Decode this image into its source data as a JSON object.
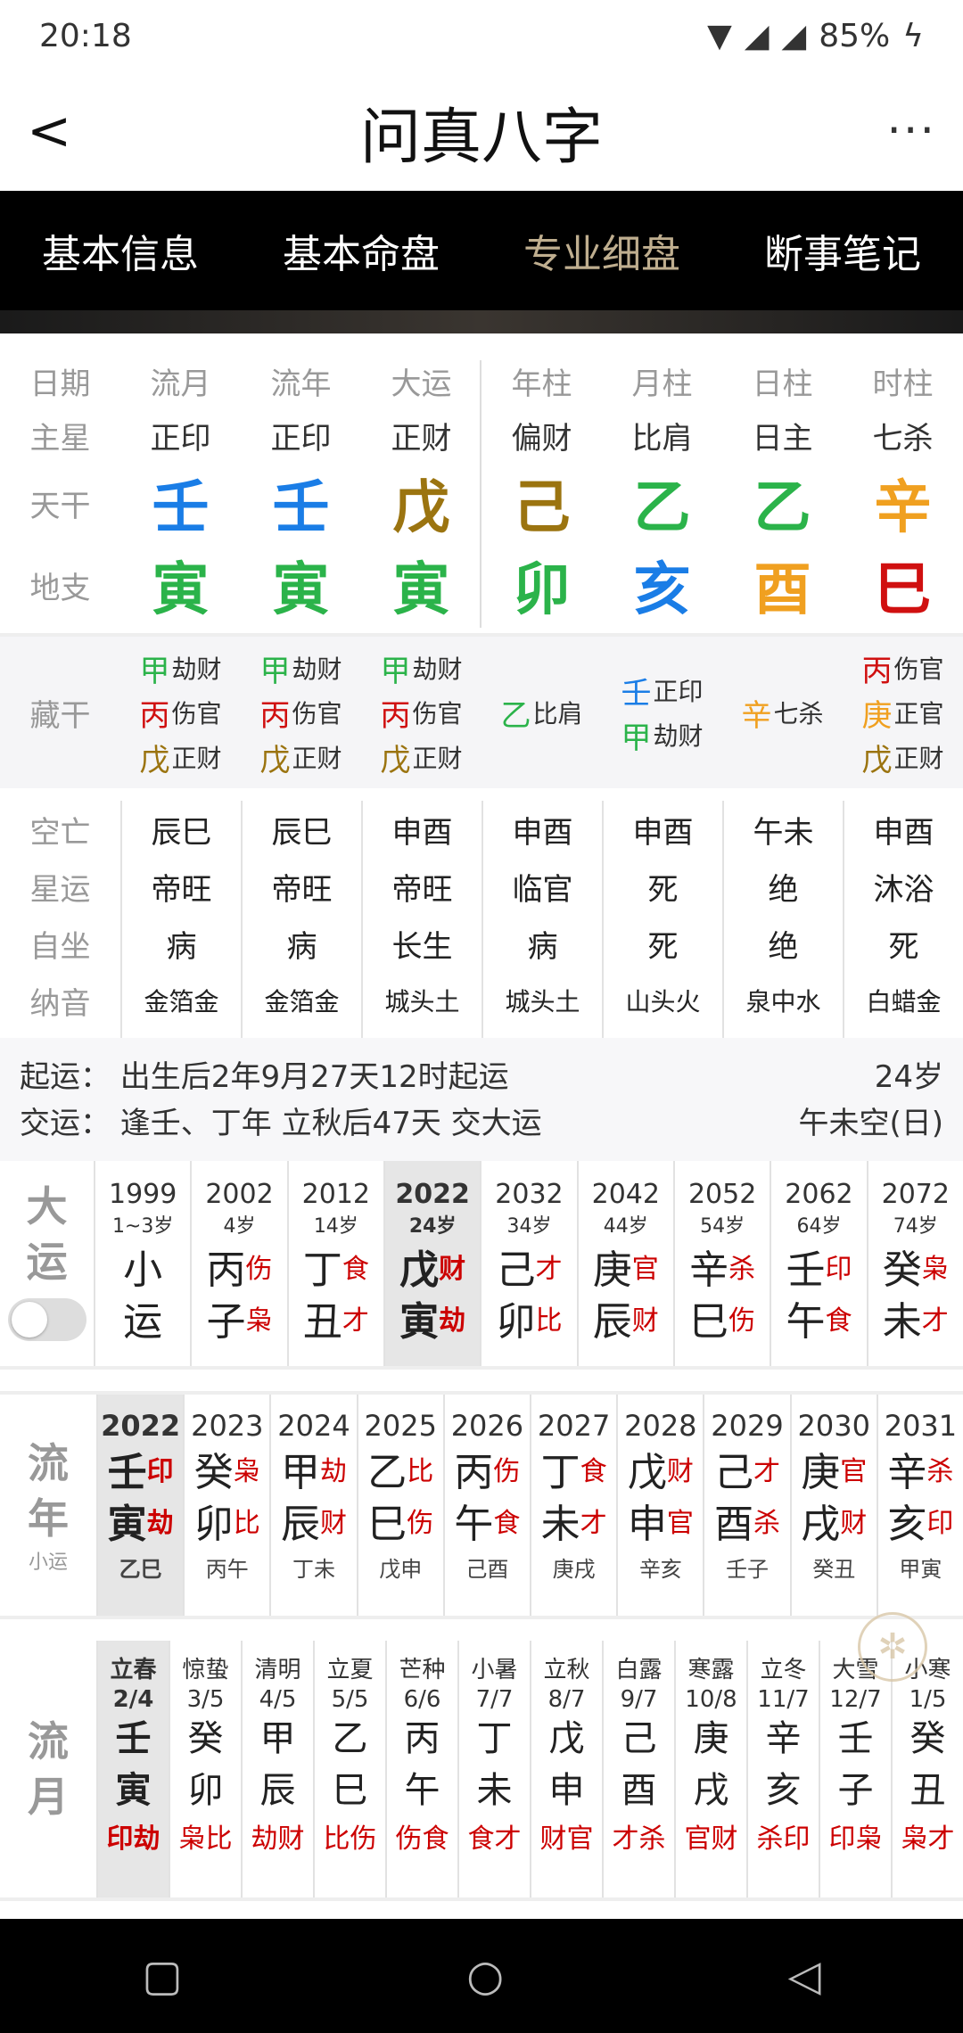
{
  "status": {
    "time": "20:18",
    "battery": "85%"
  },
  "header": {
    "title": "问真八字"
  },
  "tabs": [
    "基本信息",
    "基本命盘",
    "专业细盘",
    "断事笔记"
  ],
  "pillars": {
    "labels": [
      "日期",
      "主星",
      "天干",
      "地支"
    ],
    "heads": [
      "流月",
      "流年",
      "大运",
      "年柱",
      "月柱",
      "日柱",
      "时柱"
    ],
    "stars": [
      "正印",
      "正印",
      "正财",
      "偏财",
      "比肩",
      "日主",
      "七杀"
    ],
    "stems": [
      {
        "c": "壬",
        "color": "#1a7de6"
      },
      {
        "c": "壬",
        "color": "#1a7de6"
      },
      {
        "c": "戊",
        "color": "#9b7410"
      },
      {
        "c": "己",
        "color": "#9b7410"
      },
      {
        "c": "乙",
        "color": "#2bb34a"
      },
      {
        "c": "乙",
        "color": "#2bb34a"
      },
      {
        "c": "辛",
        "color": "#f0a020"
      }
    ],
    "branches": [
      {
        "c": "寅",
        "color": "#2bb34a"
      },
      {
        "c": "寅",
        "color": "#2bb34a"
      },
      {
        "c": "寅",
        "color": "#2bb34a"
      },
      {
        "c": "卯",
        "color": "#2bb34a"
      },
      {
        "c": "亥",
        "color": "#1a7de6"
      },
      {
        "c": "酉",
        "color": "#f0a020"
      },
      {
        "c": "巳",
        "color": "#d01010"
      }
    ]
  },
  "hidden": {
    "label": "藏干",
    "cols": [
      [
        {
          "g": "甲",
          "gc": "#2bb34a",
          "s": "劫财"
        },
        {
          "g": "丙",
          "gc": "#d01010",
          "s": "伤官"
        },
        {
          "g": "戊",
          "gc": "#9b7410",
          "s": "正财"
        }
      ],
      [
        {
          "g": "甲",
          "gc": "#2bb34a",
          "s": "劫财"
        },
        {
          "g": "丙",
          "gc": "#d01010",
          "s": "伤官"
        },
        {
          "g": "戊",
          "gc": "#9b7410",
          "s": "正财"
        }
      ],
      [
        {
          "g": "甲",
          "gc": "#2bb34a",
          "s": "劫财"
        },
        {
          "g": "丙",
          "gc": "#d01010",
          "s": "伤官"
        },
        {
          "g": "戊",
          "gc": "#9b7410",
          "s": "正财"
        }
      ],
      [
        {
          "g": "乙",
          "gc": "#2bb34a",
          "s": "比肩"
        }
      ],
      [
        {
          "g": "壬",
          "gc": "#1a7de6",
          "s": "正印"
        },
        {
          "g": "甲",
          "gc": "#2bb34a",
          "s": "劫财"
        }
      ],
      [
        {
          "g": "辛",
          "gc": "#f0a020",
          "s": "七杀"
        }
      ],
      [
        {
          "g": "丙",
          "gc": "#d01010",
          "s": "伤官"
        },
        {
          "g": "庚",
          "gc": "#f0a020",
          "s": "正官"
        },
        {
          "g": "戊",
          "gc": "#9b7410",
          "s": "正财"
        }
      ]
    ]
  },
  "detail": {
    "labels": [
      "空亡",
      "星运",
      "自坐",
      "纳音"
    ],
    "cols": [
      [
        "辰巳",
        "帝旺",
        "病",
        "金箔金"
      ],
      [
        "辰巳",
        "帝旺",
        "病",
        "金箔金"
      ],
      [
        "申酉",
        "帝旺",
        "长生",
        "城头土"
      ],
      [
        "申酉",
        "临官",
        "病",
        "城头土"
      ],
      [
        "申酉",
        "死",
        "死",
        "山头火"
      ],
      [
        "午未",
        "绝",
        "绝",
        "泉中水"
      ],
      [
        "申酉",
        "沐浴",
        "死",
        "白蜡金"
      ]
    ]
  },
  "qiyun": {
    "line1": "起运：  出生后2年9月27天12时起运",
    "age": "24岁",
    "line2": "交运：  逢壬、丁年 立秋后47天 交大运",
    "kong": "午未空(日)"
  },
  "dayun": {
    "side": [
      "大",
      "运"
    ],
    "cols": [
      {
        "yr": "1999",
        "age": "1~3岁",
        "g": "小",
        "gs": "",
        "b": "运",
        "bs": "",
        "sel": false
      },
      {
        "yr": "2002",
        "age": "4岁",
        "g": "丙",
        "gs": "伤",
        "b": "子",
        "bs": "枭",
        "sel": false
      },
      {
        "yr": "2012",
        "age": "14岁",
        "g": "丁",
        "gs": "食",
        "b": "丑",
        "bs": "才",
        "sel": false
      },
      {
        "yr": "2022",
        "age": "24岁",
        "g": "戊",
        "gs": "财",
        "b": "寅",
        "bs": "劫",
        "sel": true
      },
      {
        "yr": "2032",
        "age": "34岁",
        "g": "己",
        "gs": "才",
        "b": "卯",
        "bs": "比",
        "sel": false
      },
      {
        "yr": "2042",
        "age": "44岁",
        "g": "庚",
        "gs": "官",
        "b": "辰",
        "bs": "财",
        "sel": false
      },
      {
        "yr": "2052",
        "age": "54岁",
        "g": "辛",
        "gs": "杀",
        "b": "巳",
        "bs": "伤",
        "sel": false
      },
      {
        "yr": "2062",
        "age": "64岁",
        "g": "壬",
        "gs": "印",
        "b": "午",
        "bs": "食",
        "sel": false
      },
      {
        "yr": "2072",
        "age": "74岁",
        "g": "癸",
        "gs": "枭",
        "b": "未",
        "bs": "才",
        "sel": false
      }
    ]
  },
  "liunian": {
    "side": [
      "流",
      "年"
    ],
    "sub": "小运",
    "cols": [
      {
        "yr": "2022",
        "g": "壬",
        "gs": "印",
        "b": "寅",
        "bs": "劫",
        "xy": "乙巳",
        "sel": true
      },
      {
        "yr": "2023",
        "g": "癸",
        "gs": "枭",
        "b": "卯",
        "bs": "比",
        "xy": "丙午",
        "sel": false
      },
      {
        "yr": "2024",
        "g": "甲",
        "gs": "劫",
        "b": "辰",
        "bs": "财",
        "xy": "丁未",
        "sel": false
      },
      {
        "yr": "2025",
        "g": "乙",
        "gs": "比",
        "b": "巳",
        "bs": "伤",
        "xy": "戊申",
        "sel": false
      },
      {
        "yr": "2026",
        "g": "丙",
        "gs": "伤",
        "b": "午",
        "bs": "食",
        "xy": "己酉",
        "sel": false
      },
      {
        "yr": "2027",
        "g": "丁",
        "gs": "食",
        "b": "未",
        "bs": "才",
        "xy": "庚戌",
        "sel": false
      },
      {
        "yr": "2028",
        "g": "戊",
        "gs": "财",
        "b": "申",
        "bs": "官",
        "xy": "辛亥",
        "sel": false
      },
      {
        "yr": "2029",
        "g": "己",
        "gs": "才",
        "b": "酉",
        "bs": "杀",
        "xy": "壬子",
        "sel": false
      },
      {
        "yr": "2030",
        "g": "庚",
        "gs": "官",
        "b": "戌",
        "bs": "财",
        "xy": "癸丑",
        "sel": false
      },
      {
        "yr": "2031",
        "g": "辛",
        "gs": "杀",
        "b": "亥",
        "bs": "印",
        "xy": "甲寅",
        "sel": false
      }
    ]
  },
  "liuyue": {
    "side": [
      "流",
      "月"
    ],
    "cols": [
      {
        "jq": "立春",
        "dt": "2/4",
        "g": "壬",
        "b": "寅",
        "ss": "印劫",
        "sel": true
      },
      {
        "jq": "惊蛰",
        "dt": "3/5",
        "g": "癸",
        "b": "卯",
        "ss": "枭比",
        "sel": false
      },
      {
        "jq": "清明",
        "dt": "4/5",
        "g": "甲",
        "b": "辰",
        "ss": "劫财",
        "sel": false
      },
      {
        "jq": "立夏",
        "dt": "5/5",
        "g": "乙",
        "b": "巳",
        "ss": "比伤",
        "sel": false
      },
      {
        "jq": "芒种",
        "dt": "6/6",
        "g": "丙",
        "b": "午",
        "ss": "伤食",
        "sel": false
      },
      {
        "jq": "小暑",
        "dt": "7/7",
        "g": "丁",
        "b": "未",
        "ss": "食才",
        "sel": false
      },
      {
        "jq": "立秋",
        "dt": "8/7",
        "g": "戊",
        "b": "申",
        "ss": "财官",
        "sel": false
      },
      {
        "jq": "白露",
        "dt": "9/7",
        "g": "己",
        "b": "酉",
        "ss": "才杀",
        "sel": false
      },
      {
        "jq": "寒露",
        "dt": "10/8",
        "g": "庚",
        "b": "戌",
        "ss": "官财",
        "sel": false
      },
      {
        "jq": "立冬",
        "dt": "11/7",
        "g": "辛",
        "b": "亥",
        "ss": "杀印",
        "sel": false
      },
      {
        "jq": "大雪",
        "dt": "12/7",
        "g": "壬",
        "b": "子",
        "ss": "印枭",
        "sel": false
      },
      {
        "jq": "小寒",
        "dt": "1/5",
        "g": "癸",
        "b": "丑",
        "ss": "枭才",
        "sel": false
      }
    ]
  }
}
